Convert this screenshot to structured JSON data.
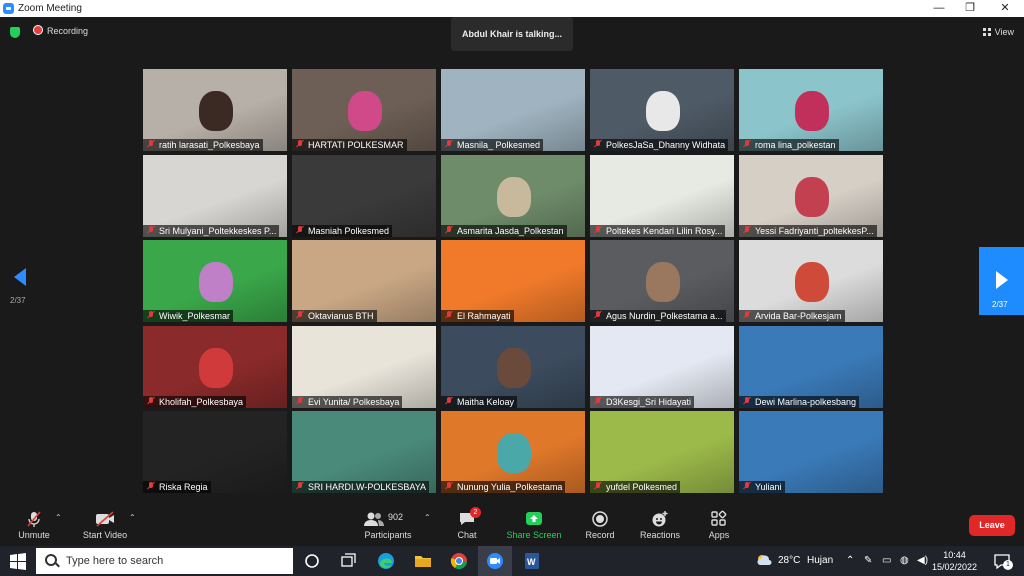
{
  "window": {
    "title": "Zoom Meeting",
    "minimize": "—",
    "restore": "❐",
    "close": "✕"
  },
  "topbar": {
    "recording": "Recording",
    "talking": "Abdul Khair is talking...",
    "view": "View"
  },
  "pager": {
    "left": "2/37",
    "right": "2/37"
  },
  "tiles": [
    {
      "name": "ratih larasati_Polkesbaya",
      "bg": "#b7b0a8",
      "person": "#3b2a24"
    },
    {
      "name": "HARTATI  POLKESMAR",
      "bg": "#6d5f55",
      "person": "#d04a8a"
    },
    {
      "name": "Masnila_ Polkesmed",
      "bg": "#9fb4c0",
      "person": ""
    },
    {
      "name": "PolkesJaSa_Dhanny Widhata",
      "bg": "#4e5a66",
      "person": "#e8e8e8"
    },
    {
      "name": "roma lina_polkestan",
      "bg": "#8cc4cc",
      "person": "#c0305a"
    },
    {
      "name": "Sri Mulyani_Poltekkeskes P...",
      "bg": "#d8d6d2",
      "person": ""
    },
    {
      "name": "Masniah Polkesmed",
      "bg": "#3a3a3a",
      "person": ""
    },
    {
      "name": "Asmarita Jasda_Polkestan",
      "bg": "#6e8c6a",
      "person": "#c8b89c"
    },
    {
      "name": "Poltekes Kendari Lilin Rosy...",
      "bg": "#e6eae2",
      "person": ""
    },
    {
      "name": "Yessi Fadriyanti_poltekkesP...",
      "bg": "#d6cfc6",
      "person": "#c24050"
    },
    {
      "name": "Wiwik_Polkesmar",
      "bg": "#3aa84a",
      "person": "#c080c8"
    },
    {
      "name": "Oktavianus BTH",
      "bg": "#c9a784",
      "person": ""
    },
    {
      "name": "El Rahmayati",
      "bg": "#f07a2a",
      "person": ""
    },
    {
      "name": "Agus Nurdin_Polkestama a...",
      "bg": "#5a5c60",
      "person": "#9a7860"
    },
    {
      "name": "Arvida Bar-Polkesjam",
      "bg": "#dcdcdc",
      "person": "#d04a3a"
    },
    {
      "name": "Kholifah_Polkesbaya",
      "bg": "#8a2a2a",
      "person": "#d03a3a"
    },
    {
      "name": "Evi Yunita/ Polkesbaya",
      "bg": "#e8e4da",
      "person": ""
    },
    {
      "name": "Maitha Keloay",
      "bg": "#3c4c5e",
      "person": "#6a4a3a"
    },
    {
      "name": "D3Kesgi_Sri Hidayati",
      "bg": "#e4e8f2",
      "person": ""
    },
    {
      "name": "Dewi Marlina-polkesbang",
      "bg": "#3a7ab8",
      "person": ""
    },
    {
      "name": "Riska Regia",
      "bg": "#232323",
      "person": ""
    },
    {
      "name": "SRI HARDI.W-POLKESBAYA",
      "bg": "#4a8a7a",
      "person": ""
    },
    {
      "name": "Nunung Yulia_Polkestama",
      "bg": "#e0782a",
      "person": "#4aa8a8"
    },
    {
      "name": "yufdel Polkesmed",
      "bg": "#9cba4a",
      "person": ""
    },
    {
      "name": "Yuliani",
      "bg": "#3a7ab8",
      "person": ""
    }
  ],
  "toolbar": {
    "unmute": "Unmute",
    "start_video": "Start Video",
    "participants": "Participants",
    "participants_count": "902",
    "chat": "Chat",
    "chat_badge": "2",
    "share": "Share Screen",
    "record": "Record",
    "reactions": "Reactions",
    "apps": "Apps",
    "leave": "Leave"
  },
  "taskbar": {
    "search": "Type here to search",
    "temperature": "28°C",
    "weather": "Hujan",
    "time": "10:44",
    "date": "15/02/2022",
    "notif_count": "1"
  },
  "colors": {
    "accent": "#2d8cff",
    "share": "#23d05a",
    "leave": "#e02828",
    "muted": "#e23a3a"
  }
}
